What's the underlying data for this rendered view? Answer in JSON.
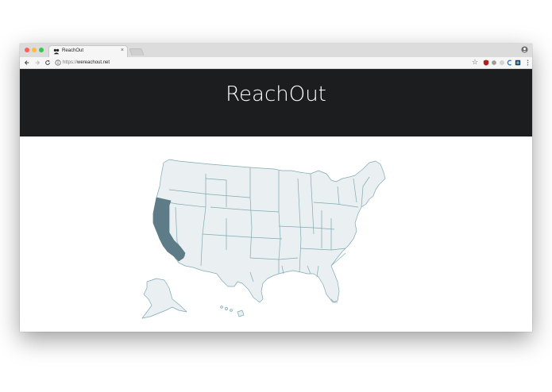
{
  "browser": {
    "tab_title": "ReachOut",
    "tab_close_glyph": "×",
    "url_scheme": "https://",
    "url_host": "wereachout.net",
    "bookmark_glyph": "☆",
    "icons": [
      "back-arrow-icon",
      "forward-arrow-icon",
      "reload-icon",
      "info-icon",
      "star-icon",
      "extension-icon",
      "menu-icon",
      "profile-icon"
    ]
  },
  "site": {
    "title": "ReachOut"
  },
  "map": {
    "highlighted_state": "California",
    "colors": {
      "highlight": "#5e7c87",
      "state_fill": "#eaeff1",
      "state_border": "#7faab3",
      "header_bg": "#1c1d1f"
    }
  }
}
